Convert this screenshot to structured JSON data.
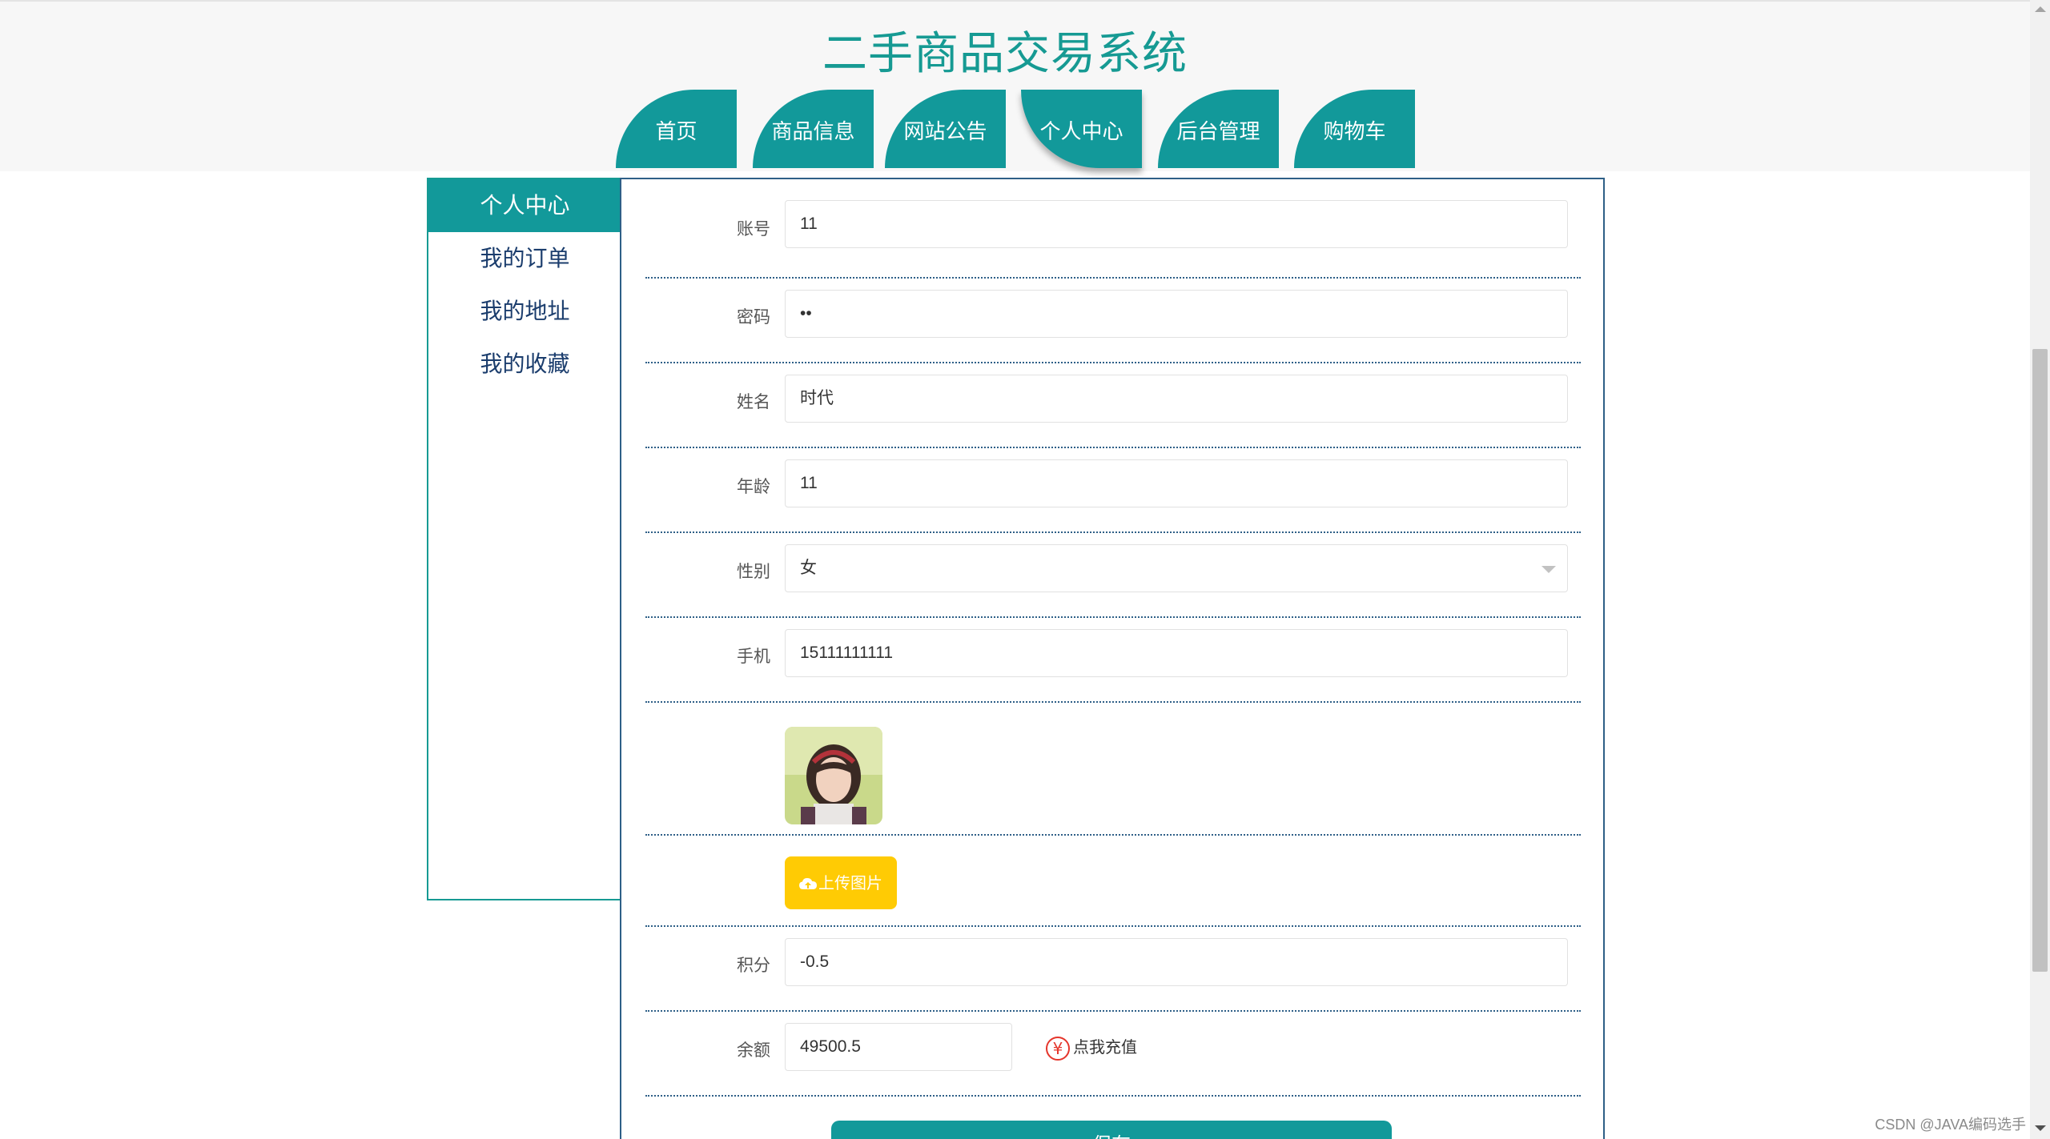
{
  "header": {
    "title": "二手商品交易系统",
    "nav": [
      {
        "label": "首页"
      },
      {
        "label": "商品信息"
      },
      {
        "label": "网站公告"
      },
      {
        "label": "个人中心",
        "active": true
      },
      {
        "label": "后台管理"
      },
      {
        "label": "购物车"
      }
    ]
  },
  "sidebar": {
    "items": [
      {
        "label": "个人中心",
        "active": true
      },
      {
        "label": "我的订单"
      },
      {
        "label": "我的地址"
      },
      {
        "label": "我的收藏"
      }
    ]
  },
  "form": {
    "account": {
      "label": "账号",
      "value": "11"
    },
    "password": {
      "label": "密码",
      "value": "••"
    },
    "name": {
      "label": "姓名",
      "value": "时代"
    },
    "age": {
      "label": "年龄",
      "value": "11"
    },
    "gender": {
      "label": "性别",
      "value": "女"
    },
    "phone": {
      "label": "手机",
      "value": "15111111111"
    },
    "avatar": {
      "icon": "avatar-photo"
    },
    "upload_label": "上传图片",
    "points": {
      "label": "积分",
      "value": "-0.5"
    },
    "balance": {
      "label": "余额",
      "value": "49500.5"
    },
    "recharge_label": "点我充值",
    "submit_label": "保存"
  },
  "watermark": "CSDN @JAVA编码选手",
  "colors": {
    "accent": "#12999a",
    "upload": "#ffcb04",
    "yen": "#e5352b",
    "border": "#2e5f87"
  }
}
